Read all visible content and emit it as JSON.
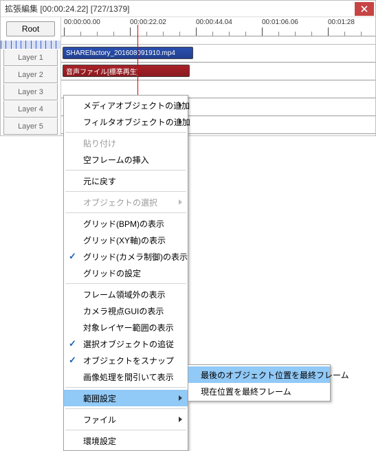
{
  "titlebar": {
    "text": "拡張編集 [00:00:24.22] [727/1379]"
  },
  "root_button": "Root",
  "ruler": {
    "labels": [
      "00:00:00.00",
      "00:00:22.02",
      "00:00:44.04",
      "00:01:06.06",
      "00:01:28"
    ]
  },
  "layers": [
    "Layer 1",
    "Layer 2",
    "Layer 3",
    "Layer 4",
    "Layer 5"
  ],
  "clips": {
    "video": "SHAREfactory_201608091910.mp4",
    "audio": "音声ファイル[標準再生]"
  },
  "menu": {
    "add_media": "メディアオブジェクトの追加",
    "add_filter": "フィルタオブジェクトの追加",
    "paste": "貼り付け",
    "insert_blank": "空フレームの挿入",
    "undo": "元に戻す",
    "select_obj": "オブジェクトの選択",
    "grid_bpm": "グリッド(BPM)の表示",
    "grid_xy": "グリッド(XY軸)の表示",
    "grid_cam": "グリッド(カメラ制御)の表示",
    "grid_cfg": "グリッドの設定",
    "oof": "フレーム領域外の表示",
    "cam_gui": "カメラ視点GUIの表示",
    "target_range": "対象レイヤー範囲の表示",
    "follow_sel": "選択オブジェクトの追従",
    "snap": "オブジェクトをスナップ",
    "thin_img": "画像処理を間引いて表示",
    "range": "範囲設定",
    "file": "ファイル",
    "env": "環境設定"
  },
  "submenu": {
    "last_obj": "最後のオブジェクト位置を最終フレーム",
    "current": "現在位置を最終フレーム"
  }
}
